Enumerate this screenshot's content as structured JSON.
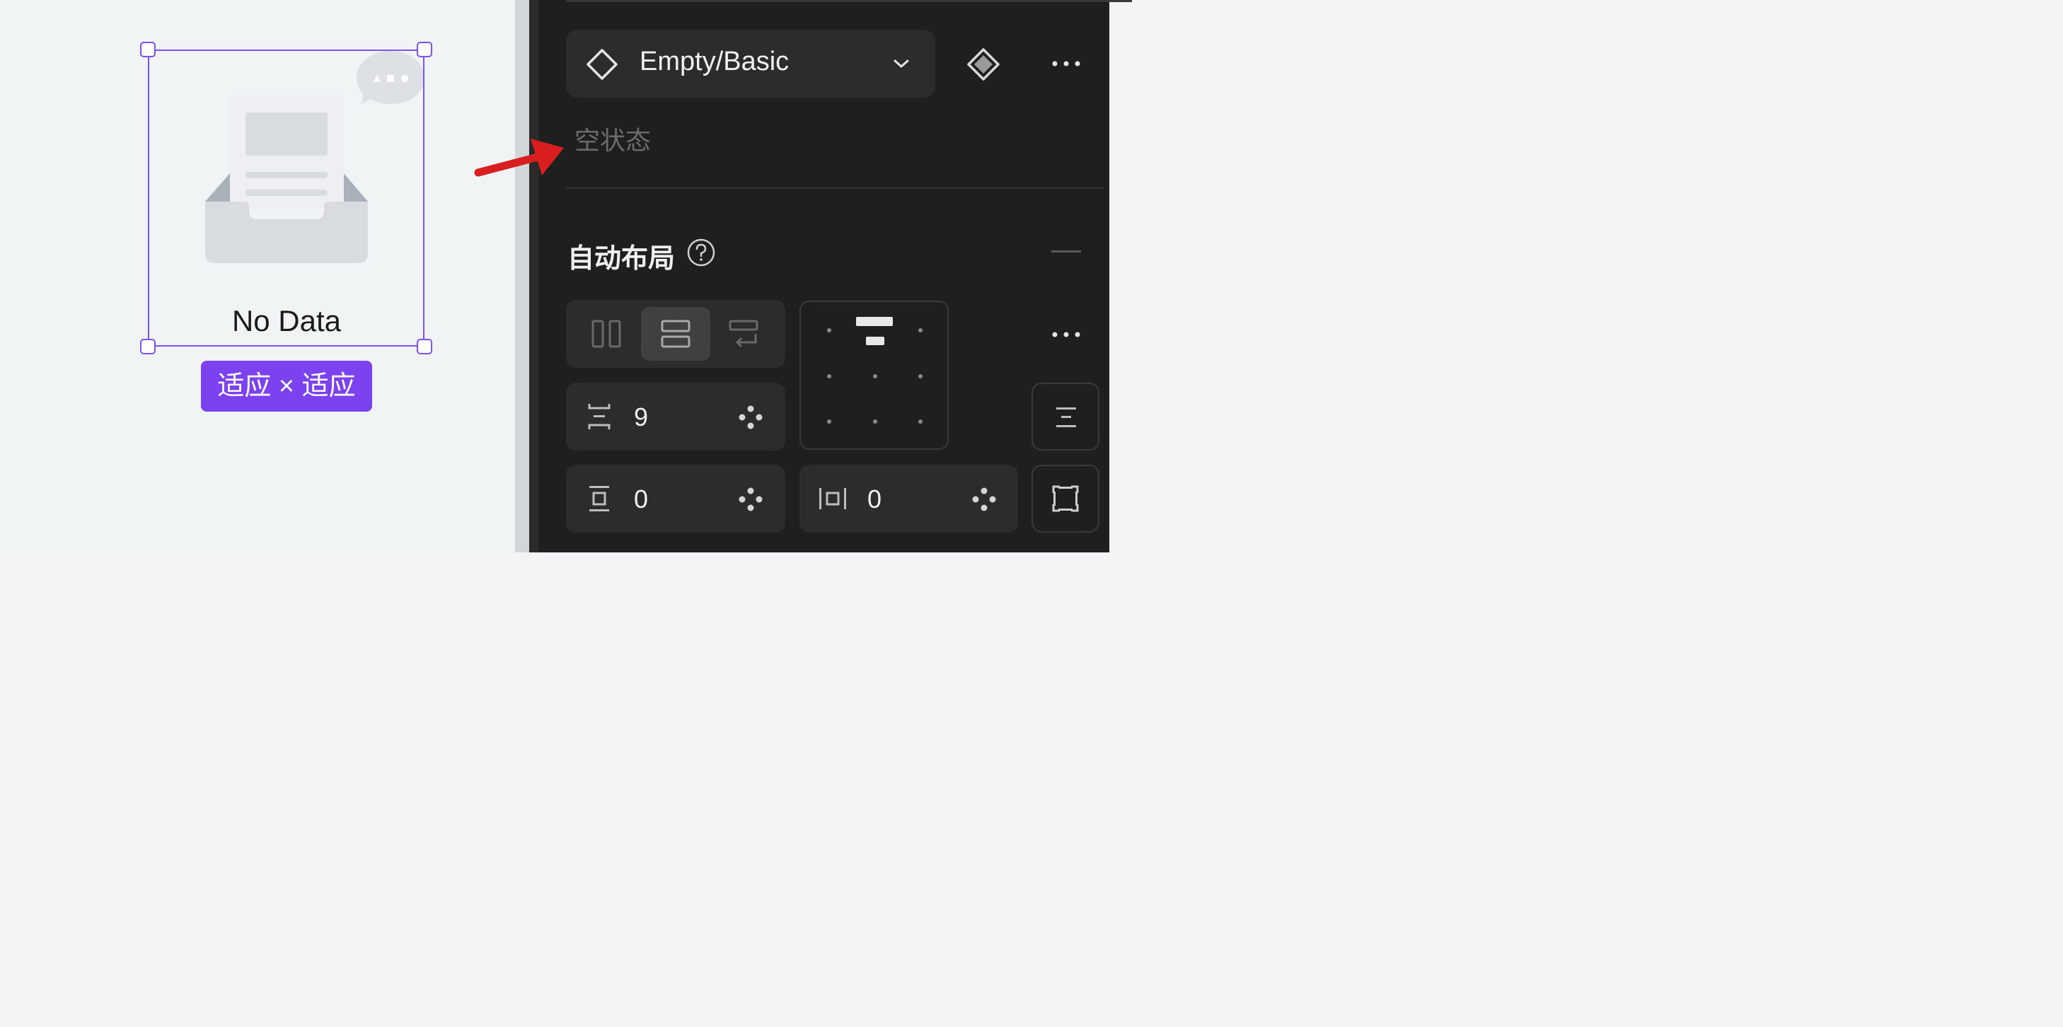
{
  "canvas": {
    "empty_label": "No Data",
    "size_badge": "适应 × 适应",
    "accent_color": "#7d52f4"
  },
  "panel": {
    "component_name": "Empty/Basic",
    "component_description": "空状态",
    "auto_layout_title": "自动布局",
    "gap_value": "9",
    "padding_vertical": "0",
    "padding_horizontal": "0"
  },
  "icons": [
    "component-icon",
    "chevron-down-icon",
    "main-component-icon",
    "more-icon",
    "help-icon",
    "collapse-icon",
    "layout-horizontal-icon",
    "layout-vertical-icon",
    "layout-wrap-icon",
    "gap-icon",
    "variable-icon",
    "padding-vertical-icon",
    "padding-horizontal-icon",
    "clip-content-icon",
    "independent-padding-icon",
    "annotation-arrow"
  ]
}
